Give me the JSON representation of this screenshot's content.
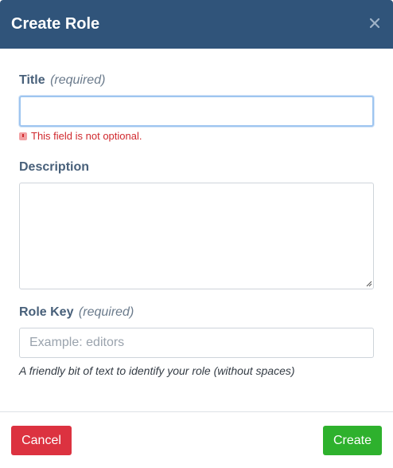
{
  "modal": {
    "title": "Create Role",
    "close_label": "×"
  },
  "form": {
    "title_field": {
      "label": "Title",
      "required_note": "(required)",
      "value": "",
      "error": "This field is not optional."
    },
    "description_field": {
      "label": "Description",
      "value": ""
    },
    "role_key_field": {
      "label": "Role Key",
      "required_note": "(required)",
      "placeholder": "Example: editors",
      "value": "",
      "help": "A friendly bit of text to identify your role (without spaces)"
    }
  },
  "footer": {
    "cancel_label": "Cancel",
    "create_label": "Create"
  },
  "colors": {
    "header_bg": "#30547a",
    "cancel_bg": "#dc3240",
    "create_bg": "#2eb12d",
    "error": "#d0292e",
    "label": "#48607a"
  },
  "icons": {
    "close": "close-icon",
    "error": "error-icon",
    "resize": "resize-grip-icon"
  }
}
